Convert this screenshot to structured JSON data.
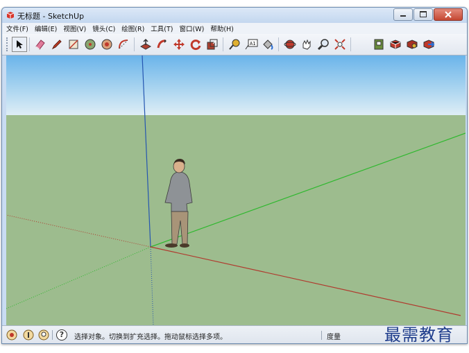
{
  "window": {
    "title": "无标题 - SketchUp"
  },
  "menu": [
    "文件(F)",
    "编辑(E)",
    "视图(V)",
    "镜头(C)",
    "绘图(R)",
    "工具(T)",
    "窗口(W)",
    "帮助(H)"
  ],
  "toolbar": {
    "tools": [
      {
        "name": "select-tool-button",
        "icon": "arrow-cursor-icon"
      },
      {
        "name": "eraser-tool-button",
        "icon": "eraser-icon"
      },
      {
        "name": "pencil-tool-button",
        "icon": "pencil-icon"
      },
      {
        "name": "rectangle-tool-button",
        "icon": "rectangle-icon"
      },
      {
        "name": "circle-tool-button",
        "icon": "circle-icon"
      },
      {
        "name": "polygon-tool-button",
        "icon": "polygon-icon"
      },
      {
        "name": "arc-tool-button",
        "icon": "arc-icon"
      },
      {
        "name": "push-pull-tool-button",
        "icon": "push-pull-icon"
      },
      {
        "name": "follow-me-tool-button",
        "icon": "follow-me-icon"
      },
      {
        "name": "move-tool-button",
        "icon": "move-icon"
      },
      {
        "name": "rotate-tool-button",
        "icon": "rotate-icon"
      },
      {
        "name": "scale-tool-button",
        "icon": "scale-icon"
      },
      {
        "name": "tape-measure-tool-button",
        "icon": "tape-measure-icon"
      },
      {
        "name": "text-tool-button",
        "icon": "text-label-icon"
      },
      {
        "name": "paint-bucket-tool-button",
        "icon": "paint-bucket-icon"
      },
      {
        "name": "orbit-tool-button",
        "icon": "orbit-icon"
      },
      {
        "name": "pan-tool-button",
        "icon": "pan-hand-icon"
      },
      {
        "name": "zoom-tool-button",
        "icon": "magnifier-icon"
      },
      {
        "name": "zoom-extents-tool-button",
        "icon": "zoom-extents-icon"
      },
      {
        "name": "scenes-tool-button",
        "icon": "book-icon"
      },
      {
        "name": "components-tool-button",
        "icon": "components-icon"
      },
      {
        "name": "warehouse-tool-button",
        "icon": "warehouse-icon"
      },
      {
        "name": "share-model-tool-button",
        "icon": "share-model-icon"
      }
    ],
    "text_tool_label": "A1"
  },
  "status": {
    "message": "选择对象。切换到扩充选择。拖动鼠标选择多项。",
    "measurement_label": "度量",
    "help_symbol": "?"
  },
  "watermark": "最需教育",
  "colors": {
    "sky_top": "#6ab4ea",
    "sky_bottom": "#dfeef6",
    "ground": "#9dbc8e",
    "red_axis": "#b03a2e",
    "green_axis": "#2eb82e",
    "blue_axis": "#2455b0"
  }
}
